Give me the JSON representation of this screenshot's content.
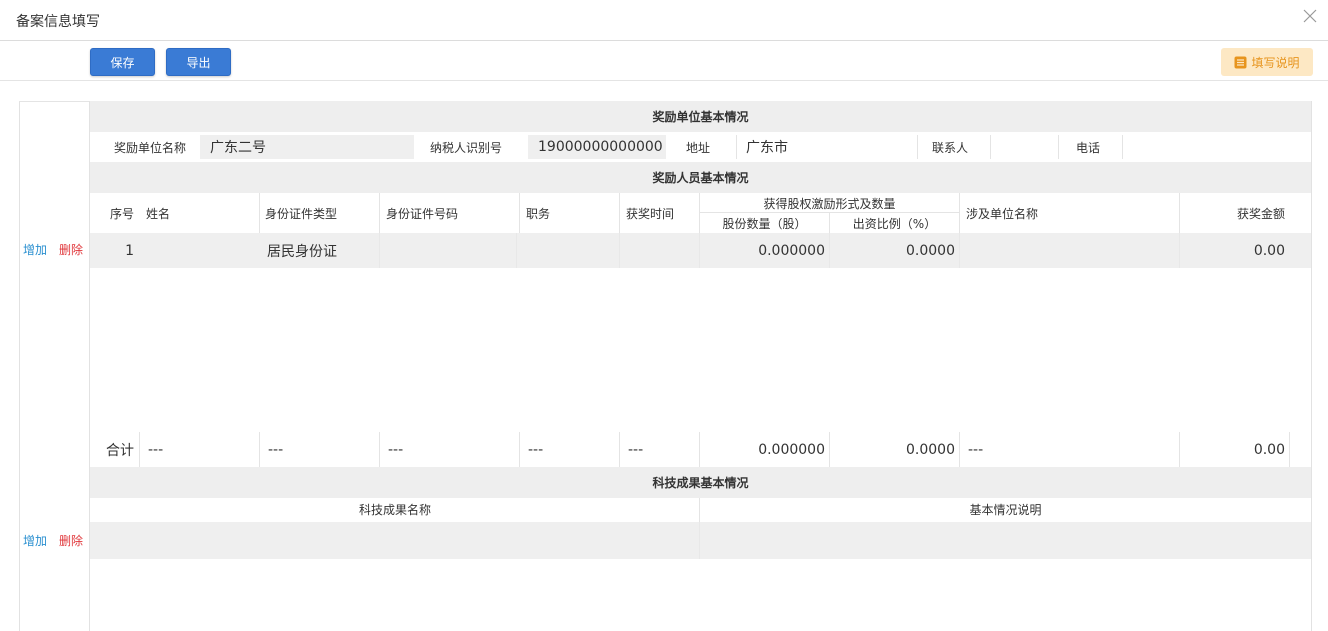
{
  "dialog": {
    "title": "备案信息填写"
  },
  "toolbar": {
    "save_label": "保存",
    "export_label": "导出",
    "help_label": "填写说明"
  },
  "unit": {
    "section_title": "奖励单位基本情况",
    "name_label": "奖励单位名称",
    "name_value": "广东二号",
    "tax_label": "纳税人识别号",
    "tax_value": "19000000000000",
    "addr_label": "地址",
    "addr_value": "广东市",
    "contact_label": "联系人",
    "contact_value": "",
    "phone_label": "电话",
    "phone_value": ""
  },
  "persons": {
    "section_title": "奖励人员基本情况",
    "add_label": "增加",
    "delete_label": "删除",
    "headers": {
      "seq": "序号",
      "name": "姓名",
      "id_type": "身份证件类型",
      "id_no": "身份证件号码",
      "position": "职务",
      "award_time": "获奖时间",
      "equity_group": "获得股权激励形式及数量",
      "shares": "股份数量（股）",
      "ratio": "出资比例（%）",
      "unit_name": "涉及单位名称",
      "amount": "获奖金额"
    },
    "rows": [
      {
        "seq": "1",
        "name": "",
        "id_type": "居民身份证",
        "id_no": "",
        "position": "",
        "award_time": "",
        "shares": "0.000000",
        "ratio": "0.0000",
        "unit_name": "",
        "amount": "0.00"
      }
    ],
    "total": {
      "label": "合计",
      "name": "---",
      "id_type": "---",
      "id_no": "---",
      "position": "---",
      "award_time": "---",
      "shares": "0.000000",
      "ratio": "0.0000",
      "unit_name": "---",
      "amount": "0.00"
    }
  },
  "tech": {
    "section_title": "科技成果基本情况",
    "add_label": "增加",
    "delete_label": "删除",
    "headers": {
      "name": "科技成果名称",
      "desc": "基本情况说明"
    }
  },
  "colors": {
    "primary": "#3a7bd5",
    "help_bg": "#fde8c4",
    "help_fg": "#e7941d",
    "add": "#2a8fd0",
    "delete": "#e0363a"
  },
  "icons": {
    "close": "close-icon",
    "help": "list-icon"
  }
}
